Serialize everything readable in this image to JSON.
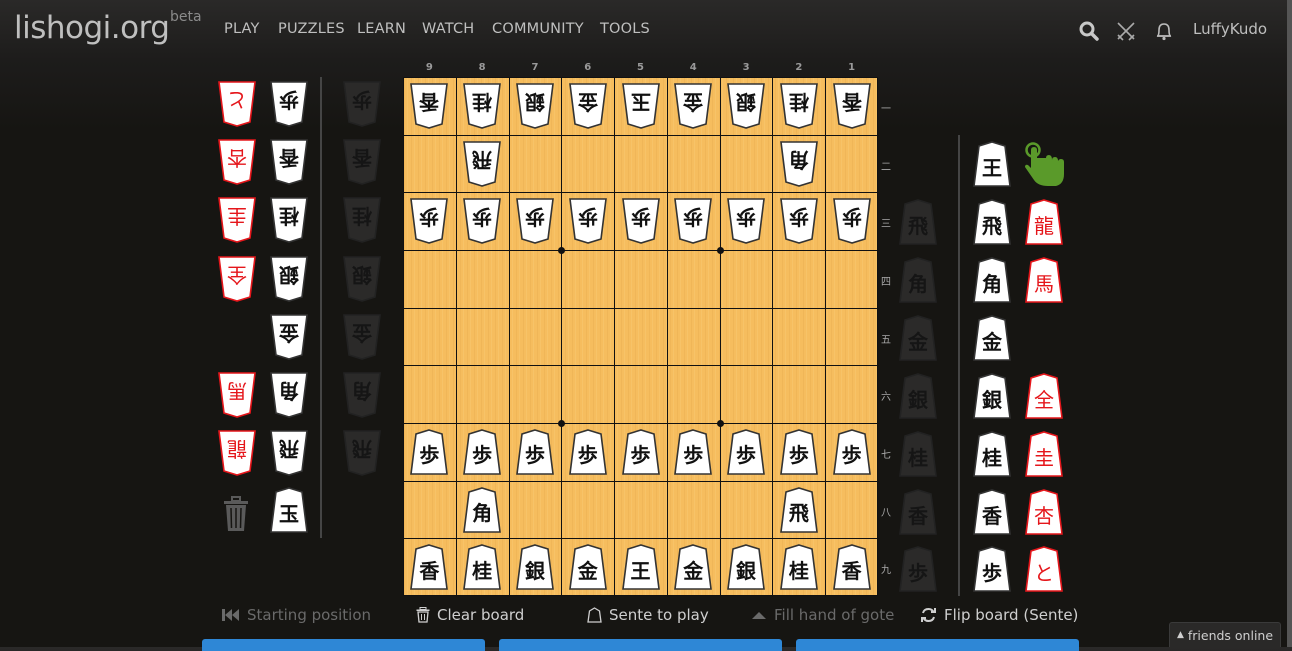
{
  "header": {
    "logo": "lishogi.org",
    "beta": "beta",
    "nav": [
      "PLAY",
      "PUZZLES",
      "LEARN",
      "WATCH",
      "COMMUNITY",
      "TOOLS"
    ],
    "icons": [
      "search-icon",
      "swords-icon",
      "bell-icon"
    ],
    "username": "LuffyKudo"
  },
  "board": {
    "files": [
      "9",
      "8",
      "7",
      "6",
      "5",
      "4",
      "3",
      "2",
      "1"
    ],
    "ranks": [
      "一",
      "二",
      "三",
      "四",
      "五",
      "六",
      "七",
      "八",
      "九"
    ],
    "position": [
      [
        {
          "k": "香",
          "side": "gote"
        },
        {
          "k": "桂",
          "side": "gote"
        },
        {
          "k": "銀",
          "side": "gote"
        },
        {
          "k": "金",
          "side": "gote"
        },
        {
          "k": "玉",
          "side": "gote"
        },
        {
          "k": "金",
          "side": "gote"
        },
        {
          "k": "銀",
          "side": "gote"
        },
        {
          "k": "桂",
          "side": "gote"
        },
        {
          "k": "香",
          "side": "gote"
        }
      ],
      [
        null,
        {
          "k": "飛",
          "side": "gote"
        },
        null,
        null,
        null,
        null,
        null,
        {
          "k": "角",
          "side": "gote"
        },
        null
      ],
      [
        {
          "k": "歩",
          "side": "gote"
        },
        {
          "k": "歩",
          "side": "gote"
        },
        {
          "k": "歩",
          "side": "gote"
        },
        {
          "k": "歩",
          "side": "gote"
        },
        {
          "k": "歩",
          "side": "gote"
        },
        {
          "k": "歩",
          "side": "gote"
        },
        {
          "k": "歩",
          "side": "gote"
        },
        {
          "k": "歩",
          "side": "gote"
        },
        {
          "k": "歩",
          "side": "gote"
        }
      ],
      [
        null,
        null,
        null,
        null,
        null,
        null,
        null,
        null,
        null
      ],
      [
        null,
        null,
        null,
        null,
        null,
        null,
        null,
        null,
        null
      ],
      [
        null,
        null,
        null,
        null,
        null,
        null,
        null,
        null,
        null
      ],
      [
        {
          "k": "歩",
          "side": "sente"
        },
        {
          "k": "歩",
          "side": "sente"
        },
        {
          "k": "歩",
          "side": "sente"
        },
        {
          "k": "歩",
          "side": "sente"
        },
        {
          "k": "歩",
          "side": "sente"
        },
        {
          "k": "歩",
          "side": "sente"
        },
        {
          "k": "歩",
          "side": "sente"
        },
        {
          "k": "歩",
          "side": "sente"
        },
        {
          "k": "歩",
          "side": "sente"
        }
      ],
      [
        null,
        {
          "k": "角",
          "side": "sente"
        },
        null,
        null,
        null,
        null,
        null,
        {
          "k": "飛",
          "side": "sente"
        },
        null
      ],
      [
        {
          "k": "香",
          "side": "sente"
        },
        {
          "k": "桂",
          "side": "sente"
        },
        {
          "k": "銀",
          "side": "sente"
        },
        {
          "k": "金",
          "side": "sente"
        },
        {
          "k": "王",
          "side": "sente"
        },
        {
          "k": "金",
          "side": "sente"
        },
        {
          "k": "銀",
          "side": "sente"
        },
        {
          "k": "桂",
          "side": "sente"
        },
        {
          "k": "香",
          "side": "sente"
        }
      ]
    ]
  },
  "spare_gote": {
    "promoted": [
      "と",
      "杏",
      "圭",
      "全",
      null,
      "馬",
      "龍"
    ],
    "normal": [
      "歩",
      "香",
      "桂",
      "銀",
      "金",
      "角",
      "飛",
      "玉"
    ]
  },
  "hand_gote": [
    "歩",
    "香",
    "桂",
    "銀",
    "金",
    "角",
    "飛"
  ],
  "hand_sente": [
    "飛",
    "角",
    "金",
    "銀",
    "桂",
    "香",
    "歩"
  ],
  "spare_sente": {
    "normal": [
      "王",
      "飛",
      "角",
      "金",
      "銀",
      "桂",
      "香",
      "歩"
    ],
    "promoted": [
      null,
      "龍",
      "馬",
      null,
      "全",
      "圭",
      "杏",
      "と"
    ]
  },
  "controls": {
    "starting_position": "Starting position",
    "clear_board": "Clear board",
    "sente_to_play": "Sente to play",
    "fill_hand": "Fill hand of gote",
    "flip_board": "Flip board (Sente)"
  },
  "friends": "friends online",
  "colors": {
    "accent": "#2e87d6",
    "board": "#f6bd5e",
    "promoted": "#e5161b",
    "pointer": "#5a9a2a"
  }
}
